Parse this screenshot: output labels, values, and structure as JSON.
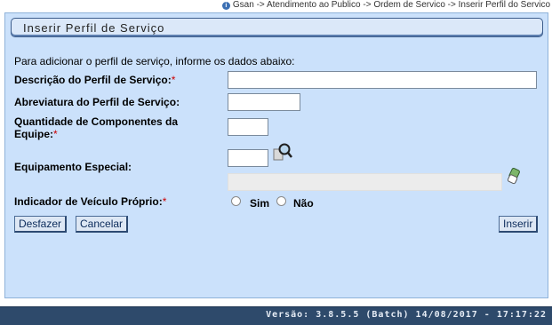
{
  "breadcrumb": {
    "text": "Gsan -> Atendimento ao Publico -> Ordem de Servico -> Inserir Perfil do Servico"
  },
  "header": {
    "title": "Inserir Perfil de Serviço"
  },
  "form": {
    "instructions": "Para adicionar o perfil de serviço, informe os dados abaixo:",
    "required_marker": "*",
    "descricao": {
      "label": "Descrição do Perfil de Serviço:",
      "value": ""
    },
    "abreviatura": {
      "label": "Abreviatura do Perfil de Serviço:",
      "value": ""
    },
    "quantidade": {
      "label_line1": "Quantidade de Componentes da",
      "label_line2": "Equipe:",
      "value": ""
    },
    "equipamento": {
      "label": "Equipamento Especial:",
      "code_value": "",
      "description_value": ""
    },
    "veiculo": {
      "label": "Indicador de Veículo Próprio:",
      "options": [
        "Sim",
        "Não"
      ],
      "selected": null
    }
  },
  "buttons": {
    "desfazer": "Desfazer",
    "cancelar": "Cancelar",
    "inserir": "Inserir"
  },
  "footer": {
    "version": "Versão: 3.8.5.5 (Batch) 14/08/2017 - 17:17:22"
  },
  "icons": {
    "breadcrumb": "info-icon",
    "search": "magnifier-icon",
    "erase": "eraser-icon"
  },
  "colors": {
    "panel_background": "#cbe1fb",
    "title_bar": "#dbe8f9",
    "footer_background": "#2e4a6b",
    "required_marker": "#cc0000"
  }
}
